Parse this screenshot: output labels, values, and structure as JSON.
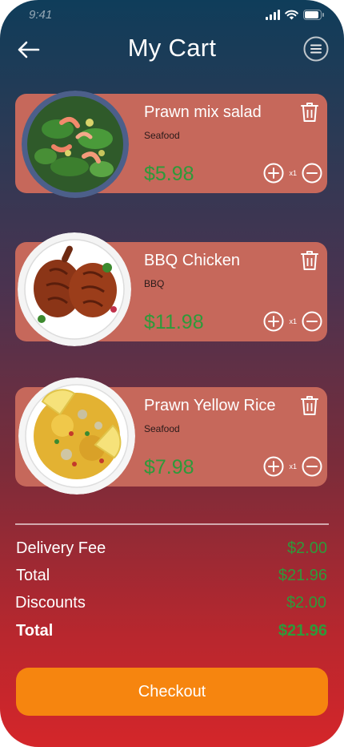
{
  "status_bar": {
    "time": "9:41"
  },
  "header": {
    "title": "My Cart"
  },
  "cart": {
    "items": [
      {
        "name": "Prawn mix salad",
        "category": "Seafood",
        "price": "$5.98",
        "qty_label": "x1"
      },
      {
        "name": "BBQ Chicken",
        "category": "BBQ",
        "price": "$11.98",
        "qty_label": "x1"
      },
      {
        "name": "Prawn Yellow Rice",
        "category": "Seafood",
        "price": "$7.98",
        "qty_label": "x1"
      }
    ]
  },
  "summary": {
    "delivery_fee_label": "Delivery Fee",
    "delivery_fee_value": "$2.00",
    "total_label": "Total",
    "total_value": "$21.96",
    "discounts_label": "Discounts",
    "discounts_value": "$2.00",
    "grand_total_label": "Total",
    "grand_total_value": "$21.96"
  },
  "checkout": {
    "label": "Checkout"
  },
  "colors": {
    "card": "#c6685b",
    "price": "#2e9a3a",
    "checkout": "#f6850f"
  },
  "icons": [
    "back-arrow-icon",
    "menu-icon",
    "trash-icon",
    "plus-icon",
    "minus-icon",
    "signal-icon",
    "wifi-icon",
    "battery-icon"
  ]
}
